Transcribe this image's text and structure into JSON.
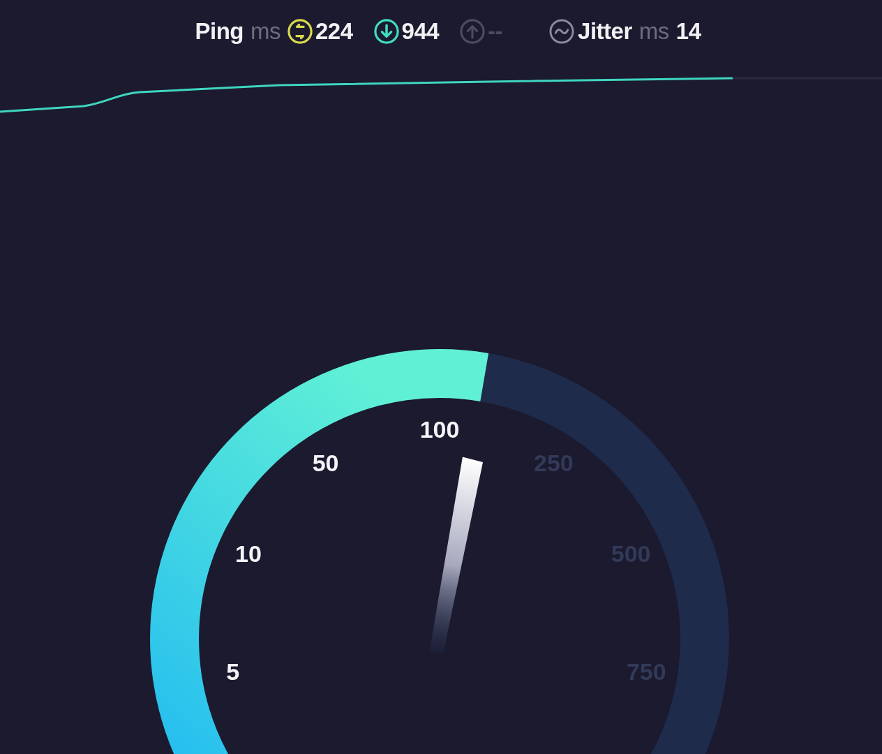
{
  "header": {
    "ping": {
      "label": "Ping",
      "unit": "ms"
    },
    "metrics": [
      {
        "kind": "ping",
        "value": "224",
        "active": true
      },
      {
        "kind": "download",
        "value": "944",
        "active": true
      },
      {
        "kind": "upload",
        "value": "--",
        "active": false
      }
    ],
    "jitter": {
      "label": "Jitter",
      "unit": "ms",
      "value": "14"
    }
  },
  "gauge": {
    "ticks": [
      {
        "label": "5",
        "reached": true
      },
      {
        "label": "10",
        "reached": true
      },
      {
        "label": "50",
        "reached": true
      },
      {
        "label": "100",
        "reached": true
      },
      {
        "label": "250",
        "reached": false
      },
      {
        "label": "500",
        "reached": false
      },
      {
        "label": "750",
        "reached": false
      }
    ]
  }
}
